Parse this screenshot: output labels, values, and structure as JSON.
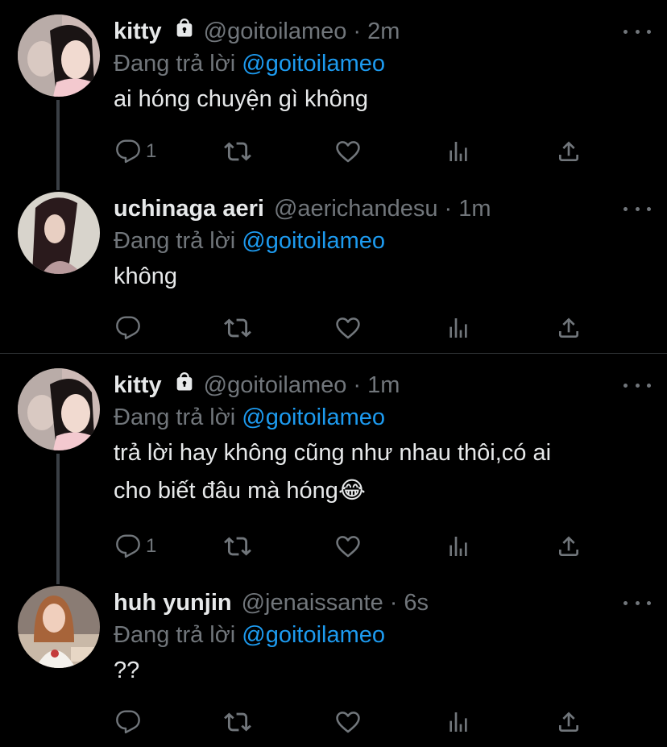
{
  "tweets": [
    {
      "name": "kitty",
      "locked": true,
      "handle": "@goitoilameo",
      "time": "2m",
      "reply_prefix": "Đang trả lời",
      "reply_to": "@goitoilameo",
      "text": "ai hóng chuyện gì không",
      "reply_count": "1"
    },
    {
      "name": "uchinaga aeri",
      "locked": false,
      "handle": "@aerichandesu",
      "time": "1m",
      "reply_prefix": "Đang trả lời",
      "reply_to": "@goitoilameo",
      "text": "không",
      "reply_count": ""
    },
    {
      "name": "kitty",
      "locked": true,
      "handle": "@goitoilameo",
      "time": "1m",
      "reply_prefix": "Đang trả lời",
      "reply_to": "@goitoilameo",
      "text_line1": "trả lời hay không cũng như nhau thôi,có ai",
      "text_line2": "cho biết đâu mà hóng",
      "emoji": "😂",
      "reply_count": "1"
    },
    {
      "name": "huh yunjin",
      "locked": false,
      "handle": "@jenaissante",
      "time": "6s",
      "reply_prefix": "Đang trả lời",
      "reply_to": "@goitoilameo",
      "text": "??",
      "reply_count": ""
    }
  ],
  "separator": "·",
  "icons": {
    "reply": "reply-icon",
    "retweet": "retweet-icon",
    "like": "like-icon",
    "analytics": "analytics-icon",
    "share": "share-icon",
    "lock": "lock-icon",
    "more": "more-icon"
  },
  "colors": {
    "background": "#000000",
    "text": "#e7e9ea",
    "muted": "#71767b",
    "link": "#1d9bf0",
    "divider": "#2f3336"
  }
}
